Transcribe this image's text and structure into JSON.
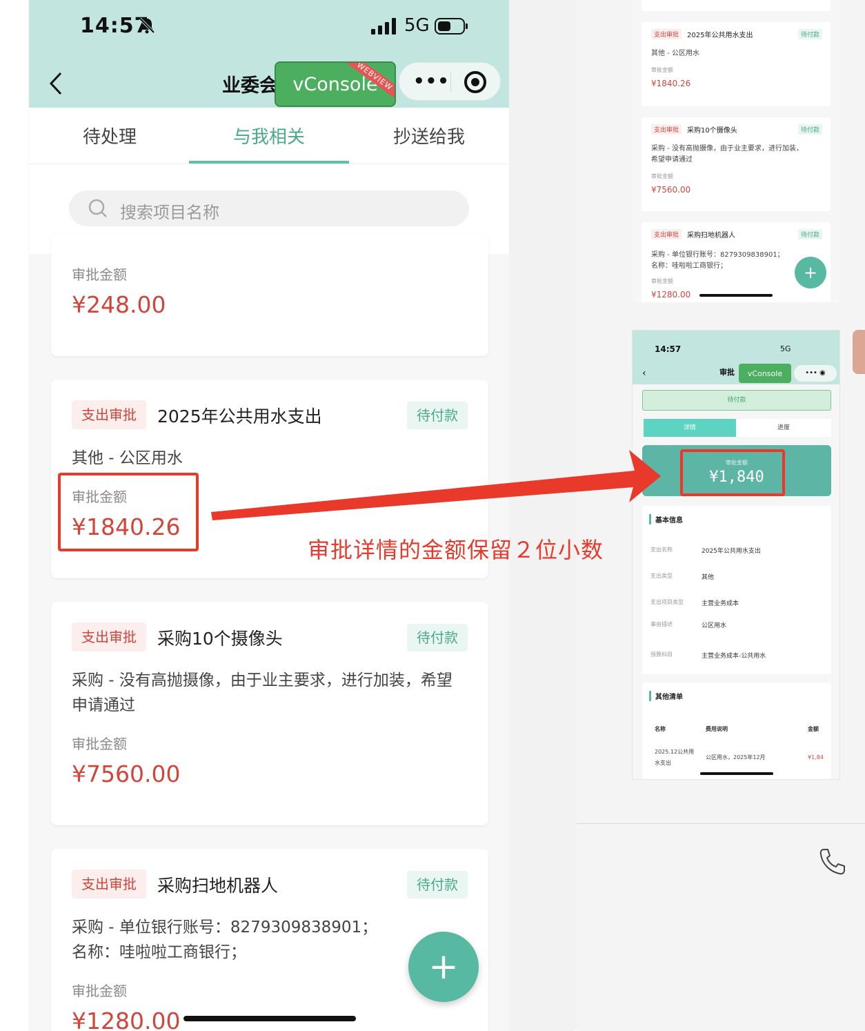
{
  "status_bar": {
    "time": "14:57",
    "network": "5G"
  },
  "nav": {
    "title": "业委会",
    "vconsole_label": "vConsole",
    "webview_tag": "WEBVIEW",
    "more_label": "•••"
  },
  "tabs": [
    {
      "label": "待处理",
      "active": false
    },
    {
      "label": "与我相关",
      "active": true
    },
    {
      "label": "抄送给我",
      "active": false
    }
  ],
  "search": {
    "placeholder": "搜索项目名称"
  },
  "cards": [
    {
      "amount_label": "审批金额",
      "amount": "¥248.00"
    },
    {
      "type": "支出审批",
      "title": "2025年公共用水支出",
      "status": "待付款",
      "desc": "其他 - 公区用水",
      "amount_label": "审批金额",
      "amount": "¥1840.26"
    },
    {
      "type": "支出审批",
      "title": "采购10个摄像头",
      "status": "待付款",
      "desc": "采购 - 没有高抛摄像，由于业主要求，进行加装，希望申请通过",
      "amount_label": "审批金额",
      "amount": "¥7560.00"
    },
    {
      "type": "支出审批",
      "title": "采购扫地机器人",
      "status": "待付款",
      "desc_line1": "采购 - 单位银行账号：8279309838901；",
      "desc_line2": "名称：哇啦啦工商银行；",
      "amount_label": "审批金额",
      "amount": "¥1280.00"
    }
  ],
  "fab_label": "+",
  "annotation": "审批详情的金额保留２位小数",
  "mini_list": {
    "cards": [
      {
        "type": "支出审批",
        "title": "2025年公共用水支出",
        "status": "待付款",
        "desc": "其他 - 公区用水",
        "amount_label": "审批金额",
        "amount": "¥1840.26"
      },
      {
        "type": "支出审批",
        "title": "采购10个摄像头",
        "status": "待付款",
        "desc_line1": "采购 - 没有高抛摄像，由于业主要求，进行加装，",
        "desc_line2": "希望申请通过",
        "amount_label": "审批金额",
        "amount": "¥7560.00"
      },
      {
        "type": "支出审批",
        "title": "采购扫地机器人",
        "status": "待付款",
        "desc_line1": "采购 - 单位银行账号：8279309838901；",
        "desc_line2": "名称：哇啦啦工商银行；",
        "amount_label": "审批金额",
        "amount": "¥1280.00"
      }
    ],
    "fab_label": "+"
  },
  "mini_detail": {
    "time": "14:57",
    "network": "5G",
    "title": "审批",
    "vconsole_label": "vConsole",
    "status": "待付款",
    "tabs": [
      "详情",
      "进度"
    ],
    "amount_label": "审批金额",
    "amount": "¥1,840",
    "basic_info_title": "基本信息",
    "basic_info": [
      {
        "key": "支出名称",
        "value": "2025年公共用水支出"
      },
      {
        "key": "支出类型",
        "value": "其他"
      },
      {
        "key": "支出项目类型",
        "value": "主营业务成本"
      },
      {
        "key": "事由描述",
        "value": "公区用水"
      },
      {
        "key": "预算科目",
        "value": "主营业务成本-公共用水"
      }
    ],
    "other_list_title": "其他清单",
    "other_list_headers": [
      "名称",
      "费用说明",
      "金额"
    ],
    "other_list_row": {
      "name_line1": "2025.12公共用",
      "name_line2": "水支出",
      "note": "公区用水，2025年12月",
      "amount": "¥1,84"
    }
  }
}
